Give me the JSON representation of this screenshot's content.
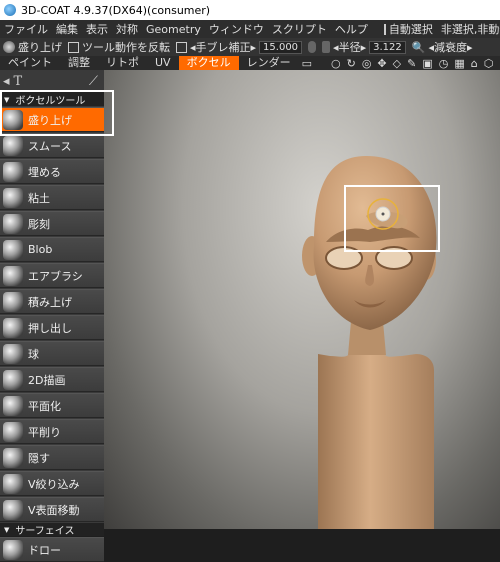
{
  "window": {
    "title": "3D-COAT 4.9.37(DX64)(consumer)"
  },
  "menu": {
    "items": [
      "ファイル",
      "編集",
      "表示",
      "対称",
      "Geometry",
      "ウィンドウ",
      "スクリプト",
      "ヘルプ"
    ],
    "auto_select": "自動選択",
    "status": "非選択,非動作"
  },
  "toolbar": {
    "tool_name": "盛り上げ",
    "invert_label": "ツール動作を反転",
    "stabilize_label": "◂手ブレ補正▸",
    "stabilize_value": "15.000",
    "radius_label": "◂半径▸",
    "radius_value": "3.122",
    "falloff_label": "◂減衰度▸"
  },
  "tabs": [
    "ペイント",
    "調整",
    "リトポ",
    "UV",
    "ボクセル",
    "レンダー"
  ],
  "active_tab": "ボクセル",
  "panel": {
    "section_voxel": "ボクセルツール",
    "tools": [
      "盛り上げ",
      "スムース",
      "埋める",
      "粘土",
      "彫刻",
      "Blob",
      "エアブラシ",
      "積み上げ",
      "押し出し",
      "球",
      "2D描画",
      "平面化",
      "平削り",
      "隠す",
      "V絞り込み",
      "V表面移動"
    ],
    "section_surface": "サーフェイス",
    "surface_tools": [
      "ドロー"
    ]
  },
  "colors": {
    "accent": "#ff6a00",
    "highlight_box": "#ffffff",
    "brush_ring": "#e8b23a",
    "model_skin": "#c79a72"
  }
}
